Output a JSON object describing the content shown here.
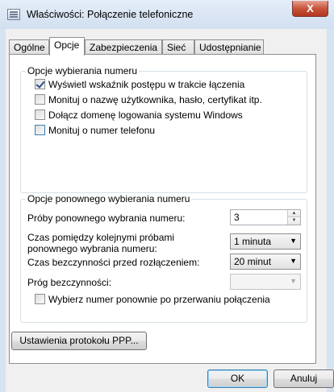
{
  "window": {
    "title": "Właściwości: Połączenie telefoniczne",
    "close_label": "X"
  },
  "tabs": [
    {
      "label": "Ogólne",
      "active": false
    },
    {
      "label": "Opcje",
      "active": true
    },
    {
      "label": "Zabezpieczenia",
      "active": false
    },
    {
      "label": "Sieć",
      "active": false
    },
    {
      "label": "Udostępnianie",
      "active": false
    }
  ],
  "dialing_options": {
    "legend": "Opcje wybierania numeru",
    "items": [
      {
        "label": "Wyświetl wskaźnik postępu w trakcie łączenia",
        "checked": true
      },
      {
        "label": "Monituj o nazwę użytkownika, hasło, certyfikat itp.",
        "checked": false
      },
      {
        "label": "Dołącz domenę logowania systemu Windows",
        "checked": false
      },
      {
        "label": "Monituj o numer telefonu",
        "checked": false
      }
    ]
  },
  "redial_options": {
    "legend": "Opcje ponownego wybierania numeru",
    "attempts_label": "Próby ponownego wybrania numeru:",
    "attempts_value": "3",
    "interval_label": "Czas pomiędzy kolejnymi próbami ponownego wybrania numeru:",
    "interval_value": "1 minuta",
    "idle_label": "Czas bezczynności przed rozłączeniem:",
    "idle_value": "20 minut",
    "threshold_label": "Próg bezczynności:",
    "threshold_value": "",
    "redial_on_drop_label": "Wybierz numer ponownie po przerwaniu połączenia",
    "redial_on_drop_checked": false
  },
  "ppp_button": "Ustawienia protokołu PPP...",
  "footer": {
    "ok": "OK",
    "cancel": "Anuluj"
  }
}
